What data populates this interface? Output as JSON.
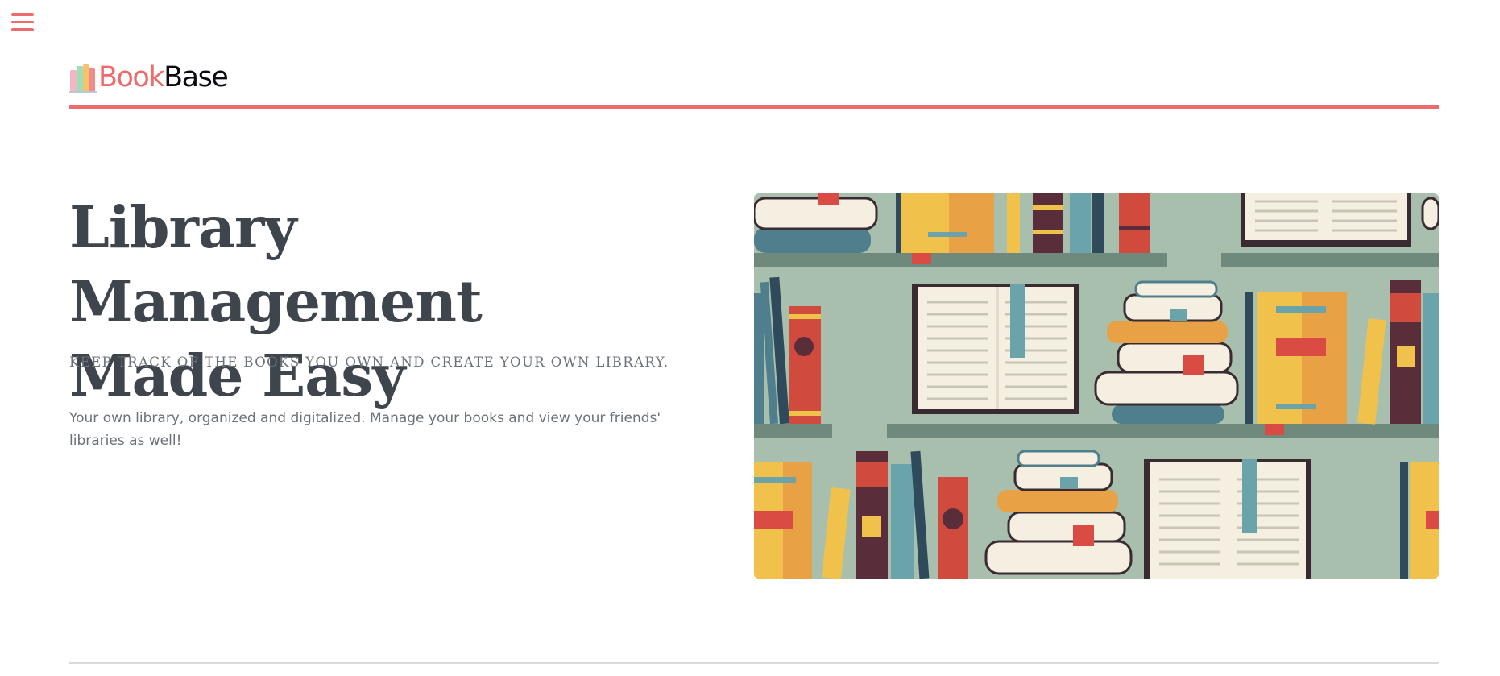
{
  "nav": {
    "menu_icon": "hamburger-menu-icon"
  },
  "brand": {
    "name_part1": "Book",
    "name_part2": "Base",
    "logo_icon": "books-logo-icon",
    "color_accent": "#ef6a6a",
    "color_dark": "#0c0c10"
  },
  "hero": {
    "title_line1": "Library Management",
    "title_line2": "Made Easy",
    "tagline": "KEEP TRACK OF THE BOOKS YOU OWN AND CREATE YOUR OWN LIBRARY.",
    "description": "Your own library, organized and digitalized. Manage your books and view your friends' libraries as well!",
    "image_icon": "bookshelf-illustration"
  },
  "colors": {
    "accent": "#ef6a6a",
    "heading": "#3e454d",
    "muted": "#6b7178",
    "shelf_bg": "#a9bfae",
    "shelf_plank": "#6f8a7c"
  }
}
